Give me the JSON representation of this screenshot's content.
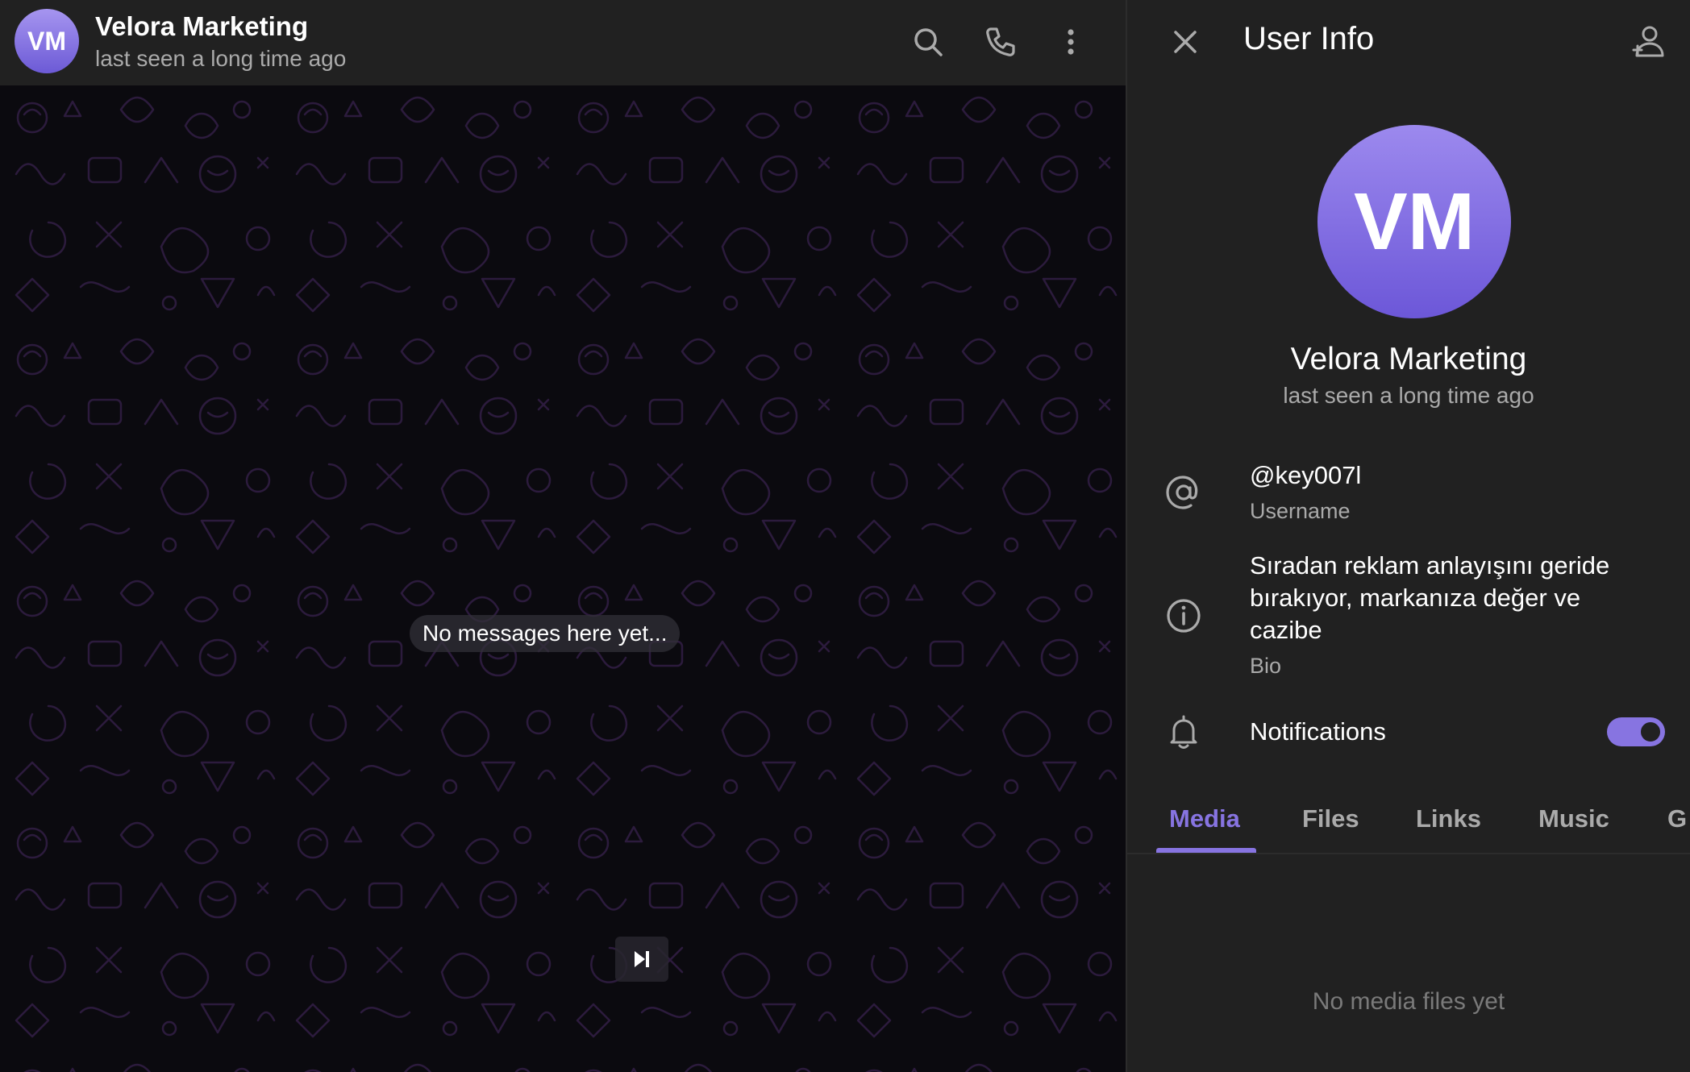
{
  "colors": {
    "accent": "#8774e1",
    "header_bg": "#212121",
    "panel_bg": "#212121",
    "wallpaper_bg": "#0b0a0f",
    "doodle_stroke": "#2a1a3a",
    "muted_text": "#aaaaaa"
  },
  "chat": {
    "avatar_initials": "VM",
    "title": "Velora Marketing",
    "status": "last seen a long time ago",
    "empty_message": "No messages here yet...",
    "header_icons": [
      "search-icon",
      "phone-icon",
      "more-vertical-icon"
    ],
    "bottom_button_icon": "skip-forward-icon"
  },
  "info": {
    "title": "User Info",
    "avatar_initials": "VM",
    "name": "Velora Marketing",
    "status": "last seen a long time ago",
    "username": {
      "value": "@key007l",
      "label": "Username"
    },
    "bio": {
      "value": "Sıradan reklam anlayışını geride bırakıyor, markanıza değer ve cazibe",
      "label": "Bio"
    },
    "notifications": {
      "label": "Notifications",
      "enabled": true
    },
    "tabs": [
      {
        "label": "Media",
        "active": true
      },
      {
        "label": "Files",
        "active": false
      },
      {
        "label": "Links",
        "active": false
      },
      {
        "label": "Music",
        "active": false
      },
      {
        "label": "G",
        "active": false
      }
    ],
    "empty_media": "No media files yet"
  }
}
